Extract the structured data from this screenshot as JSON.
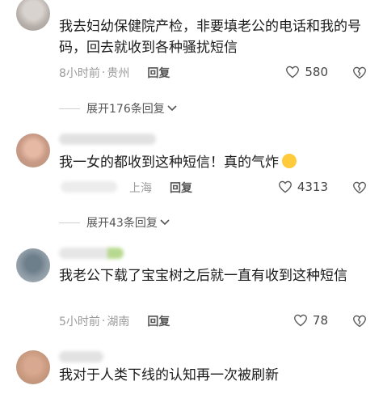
{
  "comments": [
    {
      "text": "我去妇幼保健院产检，非要填老公的电话和我的号码，回去就收到各种骚扰短信",
      "time": "8小时前",
      "dot": "·",
      "location": "贵州",
      "reply": "回复",
      "likes": "580",
      "expand": "展开176条回复"
    },
    {
      "text": "我一女的都收到这种短信！真的气炸",
      "time": "",
      "location": "上海",
      "reply": "回复",
      "likes": "4313",
      "expand": "展开43条回复"
    },
    {
      "text": "我老公下载了宝宝树之后就一直有收到这种短信",
      "time": "5小时前",
      "dot": "·",
      "location": "湖南",
      "reply": "回复",
      "likes": "78"
    },
    {
      "text": "我对于人类下线的认知再一次被刷新"
    }
  ],
  "icons": {
    "like": "heart-outline-icon",
    "dislike": "broken-heart-icon",
    "expand": "chevron-down-icon"
  },
  "colors": {
    "meta": "#9a9a9a",
    "text": "#1a1a1a",
    "emoji": "#ffcb3b"
  }
}
